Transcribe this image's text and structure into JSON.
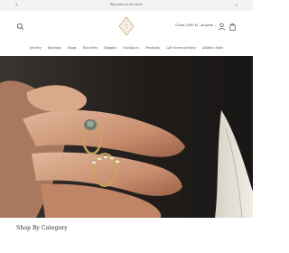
{
  "announcement": {
    "message": "Welcome to our store",
    "prev_icon": "chevron-left-icon",
    "next_icon": "chevron-right-icon"
  },
  "header": {
    "search_icon": "search-icon",
    "logo": "diamond-logo",
    "country": "China (CNY ¥)",
    "language": "English",
    "account_icon": "account-icon",
    "cart_icon": "cart-icon"
  },
  "nav": {
    "items": [
      "Jewelry",
      "Earrings",
      "Rings",
      "Bracelets",
      "Bangles",
      "Necklaces",
      "Pendants",
      "Lab-Grown jewelry",
      "Athletic Style"
    ]
  },
  "hero": {
    "image": "hand-with-diamond-rings"
  },
  "section": {
    "title": "Shop By Category"
  },
  "colors": {
    "nav_link": "#6b4f3a",
    "logo_gold": "#c8a36a",
    "announcement_bg": "#f3f3f3"
  }
}
